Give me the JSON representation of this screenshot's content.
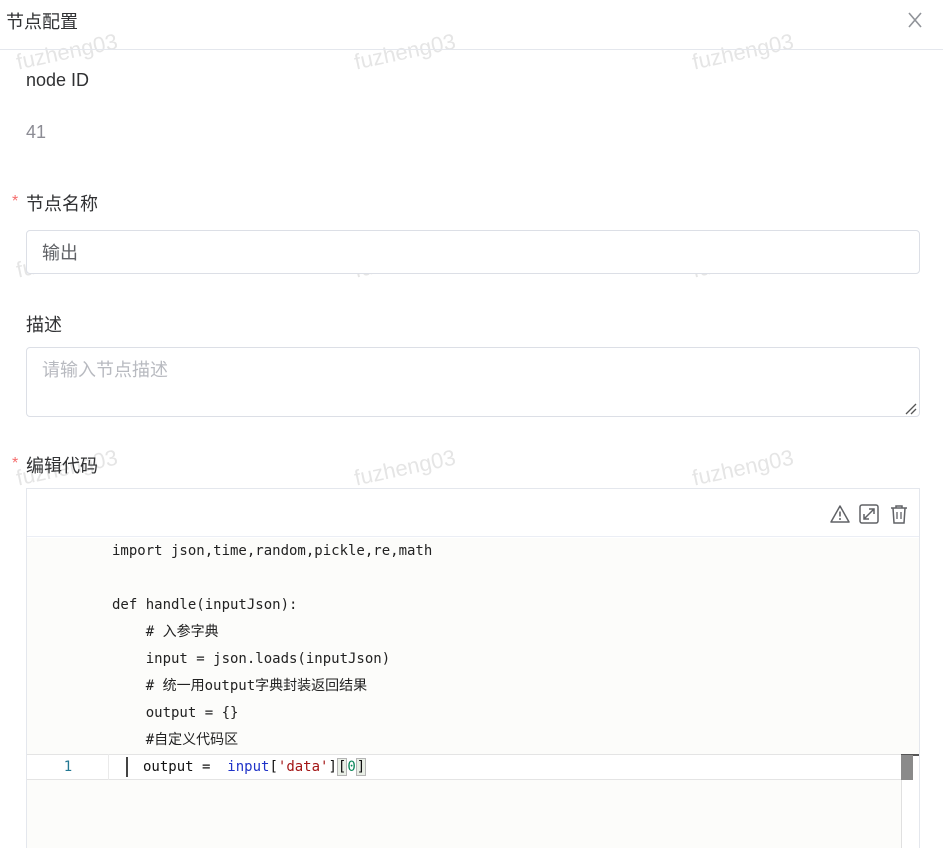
{
  "dialog": {
    "title": "节点配置"
  },
  "node_id": {
    "label": "node ID",
    "value": "41"
  },
  "node_name": {
    "required_mark": "*",
    "label": "节点名称",
    "value": "输出"
  },
  "description": {
    "label": "描述",
    "placeholder": "请输入节点描述"
  },
  "code_editor": {
    "required_mark": "*",
    "label": "编辑代码",
    "toolbar": [
      "warning-icon",
      "fullscreen-icon",
      "delete-icon"
    ],
    "template_lines": [
      "import json,time,random,pickle,re,math",
      "",
      "def handle(inputJson):",
      "    # 入参字典",
      "    input = json.loads(inputJson)",
      "    # 统一用output字典封装返回结果",
      "    output = {}",
      "    #自定义代码区"
    ],
    "current_line": {
      "number": "1",
      "var": "output",
      "op": " =  ",
      "builtin": "input",
      "open_bracket": "[",
      "string": "'data'",
      "close_bracket": "]",
      "idx_open": "[",
      "idx_value": "0",
      "idx_close": "]"
    }
  },
  "watermark": "fuzheng03",
  "colors": {
    "required": "#f56c6c",
    "builtin": "#1f33c8",
    "string": "#a31515",
    "number": "#098658"
  }
}
